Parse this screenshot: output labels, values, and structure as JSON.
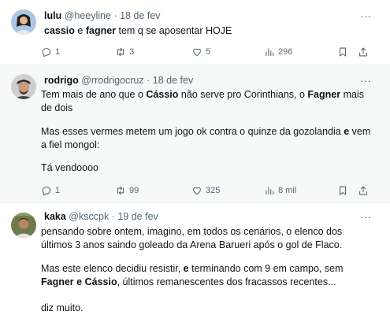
{
  "tweets": [
    {
      "name": "lulu",
      "handle": "@heeyline",
      "dot": "·",
      "date": "18 de fev",
      "more": "···",
      "line1_a": "cassio",
      "line1_b": " e ",
      "line1_c": "fagner",
      "line1_d": " tem q se aposentar HOJE",
      "stats": {
        "replies": "1",
        "retweets": "3",
        "likes": "5",
        "views": "296"
      }
    },
    {
      "name": "rodrigo",
      "handle": "@rrodrigocruz",
      "dot": "·",
      "date": "18 de fev",
      "more": "···",
      "p1_a": "Tem mais de ano que o ",
      "p1_b": "Cássio",
      "p1_c": " não serve pro Corinthians, o ",
      "p1_d": "Fagner",
      "p1_e": " mais de dois",
      "p2_a": "Mas esses vermes metem um jogo ok contra o quinze da gozolandia ",
      "p2_b": "e",
      "p2_c": " vem a fiel mongol:",
      "p3": "Tá vendoooo",
      "stats": {
        "replies": "1",
        "retweets": "99",
        "likes": "325",
        "views": "8 mil"
      }
    },
    {
      "name": "kaka",
      "handle": "@ksccpk",
      "dot": "·",
      "date": "19 de fev",
      "more": "···",
      "p1": "pensando sobre ontem, imagino, em todos os cenários, o elenco dos últimos 3 anos saindo goleado da Arena Barueri após o gol de Flaco.",
      "p2_a": "Mas este elenco decidiu resistir, ",
      "p2_b": "e",
      "p2_c": " terminando com 9 em campo, sem ",
      "p2_d": "Fagner",
      "p2_e": " ",
      "p2_f": "e",
      "p2_g": " ",
      "p2_h": "Cássio",
      "p2_i": ", últimos remanescentes dos fracassos recentes...",
      "p3": "diz muito."
    }
  ],
  "icons": {
    "reply": "reply-icon",
    "retweet": "retweet-icon",
    "like": "heart-icon",
    "views": "views-icon",
    "bookmark": "bookmark-icon",
    "share": "share-icon",
    "more": "more-icon"
  },
  "colors": {
    "text": "#0f1419",
    "secondary": "#536471",
    "highlight_bg": "#f7f9f9",
    "divider": "#eff3f4"
  }
}
